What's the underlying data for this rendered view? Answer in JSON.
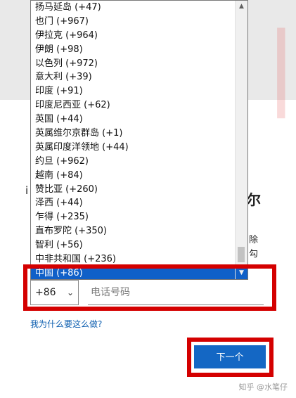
{
  "dropdown": {
    "options": [
      "扬马延岛 (+47)",
      "也门 (+967)",
      "伊拉克 (+964)",
      "伊朗 (+98)",
      "以色列 (+972)",
      "意大利 (+39)",
      "印度 (+91)",
      "印度尼西亚 (+62)",
      "英国 (+44)",
      "英属维尔京群岛 (+1)",
      "英属印度洋领地 (+44)",
      "约旦 (+962)",
      "越南 (+84)",
      "赞比亚 (+260)",
      "泽西 (+44)",
      "乍得 (+235)",
      "直布罗陀 (+350)",
      "智利 (+56)",
      "中非共和国 (+236)",
      "中国 (+86)"
    ],
    "selected": "中国 (+86)",
    "scroll_up_icon": "▲",
    "scroll_down_icon": "▼"
  },
  "background_fragments": {
    "left_1": "i",
    "right_heading": "尔",
    "right_1": "除",
    "right_2": "勾"
  },
  "form": {
    "country_code": "+86",
    "country_code_chevron": "⌄",
    "phone_placeholder": "电话号码",
    "why_link": "我为什么要这么做?",
    "next_button": "下一个"
  },
  "credit": "知乎 @水笔仔",
  "colors": {
    "selection": "#1060c8",
    "highlight": "#d40000",
    "primary_button": "#1467c4",
    "link": "#0e5fb0"
  }
}
